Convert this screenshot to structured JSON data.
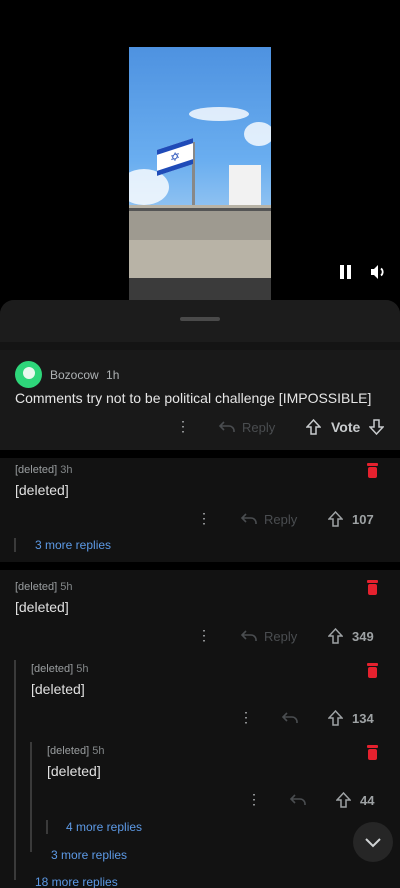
{
  "video": {
    "flag_star": "✡",
    "pause_icon": "pause-icon",
    "volume_icon": "volume-icon"
  },
  "post_comment": {
    "username": "Bozocow",
    "time": "1h",
    "body": "Comments try not to be political challenge [IMPOSSIBLE]",
    "more_icon": "⋮",
    "reply_label": "Reply",
    "vote_label": "Vote"
  },
  "comments": [
    {
      "author": "[deleted]",
      "time": "3h",
      "body": "[deleted]",
      "more_icon": "⋮",
      "reply_label": "Reply",
      "score": "107",
      "more_replies": "3 more replies"
    },
    {
      "author": "[deleted]",
      "time": "5h",
      "body": "[deleted]",
      "more_icon": "⋮",
      "reply_label": "Reply",
      "score": "349"
    },
    {
      "author": "[deleted]",
      "time": "5h",
      "body": "[deleted]",
      "more_icon": "⋮",
      "score": "134"
    },
    {
      "author": "[deleted]",
      "time": "5h",
      "body": "[deleted]",
      "more_icon": "⋮",
      "score": "44"
    }
  ],
  "thread_links": {
    "level3": "4 more replies",
    "level2": "3 more replies",
    "level1": "18 more replies"
  },
  "colors": {
    "accent_link": "#5d9ae6",
    "delete_red": "#e5212e",
    "avatar_green": "#2ed67a"
  },
  "scroll_button_icon": "chevron-down-icon"
}
